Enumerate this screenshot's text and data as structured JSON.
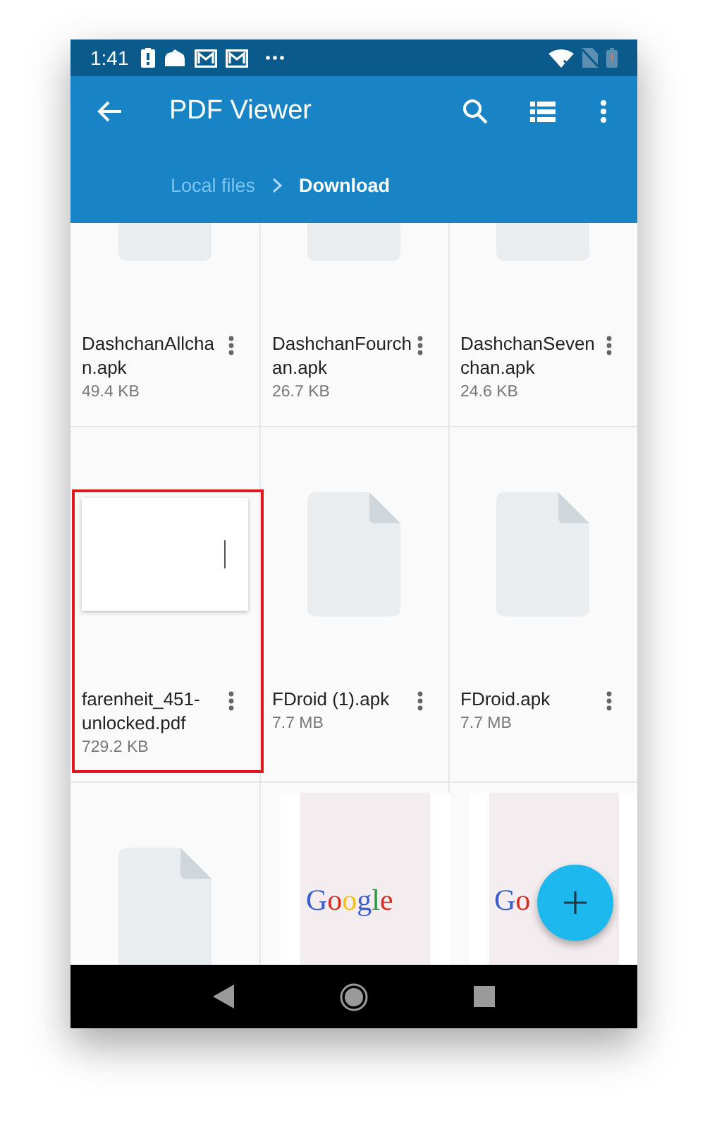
{
  "status_bar": {
    "time": "1:41"
  },
  "toolbar": {
    "title": "PDF Viewer"
  },
  "breadcrumbs": [
    {
      "label": "Local files",
      "current": false
    },
    {
      "label": "Download",
      "current": true
    }
  ],
  "files": [
    {
      "name": "DashchanAllchan.apk",
      "size": "49.4 KB",
      "kind": "file",
      "highlighted": false
    },
    {
      "name": "DashchanFourchan.apk",
      "size": "26.7 KB",
      "kind": "file",
      "highlighted": false
    },
    {
      "name": "DashchanSevenchan.apk",
      "size": "24.6 KB",
      "kind": "file",
      "highlighted": false
    },
    {
      "name": "farenheit_451-unlocked.pdf",
      "size": "729.2 KB",
      "kind": "page",
      "highlighted": true
    },
    {
      "name": "FDroid (1).apk",
      "size": "7.7 MB",
      "kind": "file",
      "highlighted": false
    },
    {
      "name": "FDroid.apk",
      "size": "7.7 MB",
      "kind": "file",
      "highlighted": false
    },
    {
      "kind": "file",
      "highlighted": false
    },
    {
      "kind": "document",
      "thumbnail_text": "Google",
      "highlighted": false
    },
    {
      "kind": "document",
      "thumbnail_text": "Go",
      "highlighted": false
    }
  ]
}
